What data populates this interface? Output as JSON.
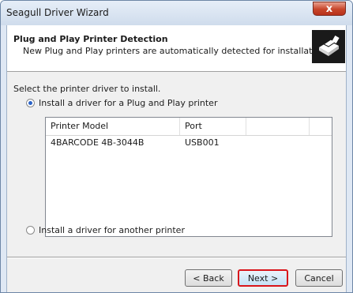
{
  "window": {
    "title": "Seagull Driver Wizard",
    "close_glyph": "x"
  },
  "header": {
    "title": "Plug and Play Printer Detection",
    "subtitle": "New Plug and Play printers are automatically detected for installation.",
    "icon": "printer-icon"
  },
  "main": {
    "prompt": "Select the printer driver to install.",
    "option_pnp": {
      "label": "Install a driver for a Plug and Play printer",
      "checked": true
    },
    "option_other": {
      "label": "Install a driver for another printer",
      "checked": false
    }
  },
  "list": {
    "columns": [
      "Printer Model",
      "Port",
      ""
    ],
    "rows": [
      {
        "model": "4BARCODE 4B-3044B",
        "port": "USB001"
      }
    ]
  },
  "buttons": {
    "back": "< Back",
    "next": "Next >",
    "cancel": "Cancel"
  },
  "colors": {
    "highlight_border": "#d9161b",
    "radio_dot": "#2a62c7"
  }
}
